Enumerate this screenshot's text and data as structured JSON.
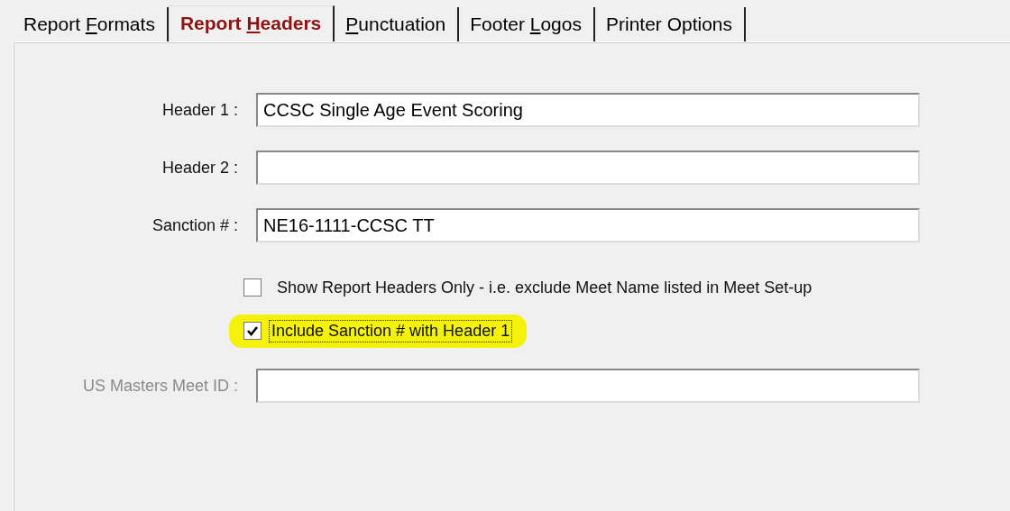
{
  "tabs": [
    {
      "before": "Report ",
      "key": "F",
      "after": "ormats",
      "selected": false
    },
    {
      "before": "Report ",
      "key": "H",
      "after": "eaders",
      "selected": true
    },
    {
      "key": "P",
      "after": "unctuation",
      "selected": false
    },
    {
      "before": "Footer ",
      "key": "L",
      "after": "ogos",
      "selected": false
    },
    {
      "before": "Printer Options",
      "selected": false
    }
  ],
  "fields_top": [
    {
      "label": "Header 1 :",
      "value": "CCSC Single Age Event Scoring",
      "disabled": false
    },
    {
      "label": "Header 2 :",
      "disabled": false
    },
    {
      "label": "Sanction # :",
      "value": "NE16-1111-CCSC TT",
      "disabled": false
    }
  ],
  "checkboxes": [
    {
      "label": "Show Report Headers Only - i.e. exclude Meet Name listed in Meet Set-up",
      "checked": false,
      "highlighted": false,
      "focused": false
    },
    {
      "label": "Include Sanction # with Header 1",
      "checked": true,
      "highlighted": true,
      "focused": true
    }
  ],
  "fields_bottom": [
    {
      "label": "US Masters Meet ID :",
      "disabled": true
    }
  ]
}
